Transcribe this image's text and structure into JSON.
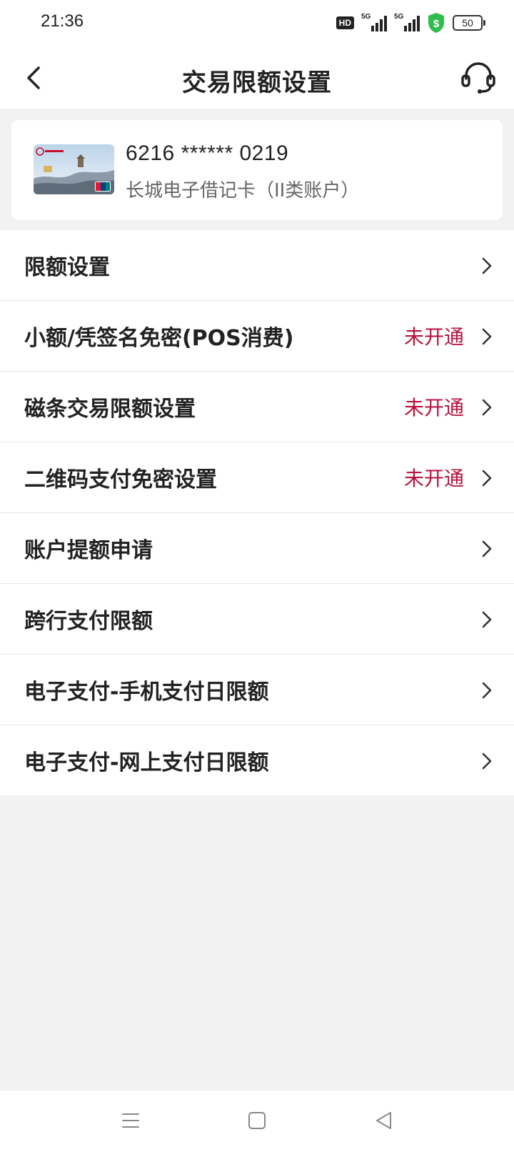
{
  "status_bar": {
    "time": "21:36",
    "hd_label": "HD",
    "network_1": "5G",
    "network_2": "5G",
    "battery": "50",
    "shield_color": "#2dbe4e"
  },
  "header": {
    "title": "交易限额设置",
    "back_icon": "chevron-left-icon",
    "service_icon": "headset-icon"
  },
  "card": {
    "number": "6216 ****** 0219",
    "name": "长城电子借记卡（II类账户）"
  },
  "menu": {
    "items": [
      {
        "label": "限额设置",
        "status": ""
      },
      {
        "label": "小额/凭签名免密(POS消费)",
        "status": "未开通"
      },
      {
        "label": "磁条交易限额设置",
        "status": "未开通"
      },
      {
        "label": "二维码支付免密设置",
        "status": "未开通"
      },
      {
        "label": "账户提额申请",
        "status": ""
      },
      {
        "label": "跨行支付限额",
        "status": ""
      },
      {
        "label": "电子支付-手机支付日限额",
        "status": ""
      },
      {
        "label": "电子支付-网上支付日限额",
        "status": ""
      }
    ],
    "status_color": "#b5123e"
  },
  "system_nav": {
    "menu_icon": "menu-icon",
    "home_icon": "square-home-icon",
    "back_icon": "triangle-back-icon"
  }
}
